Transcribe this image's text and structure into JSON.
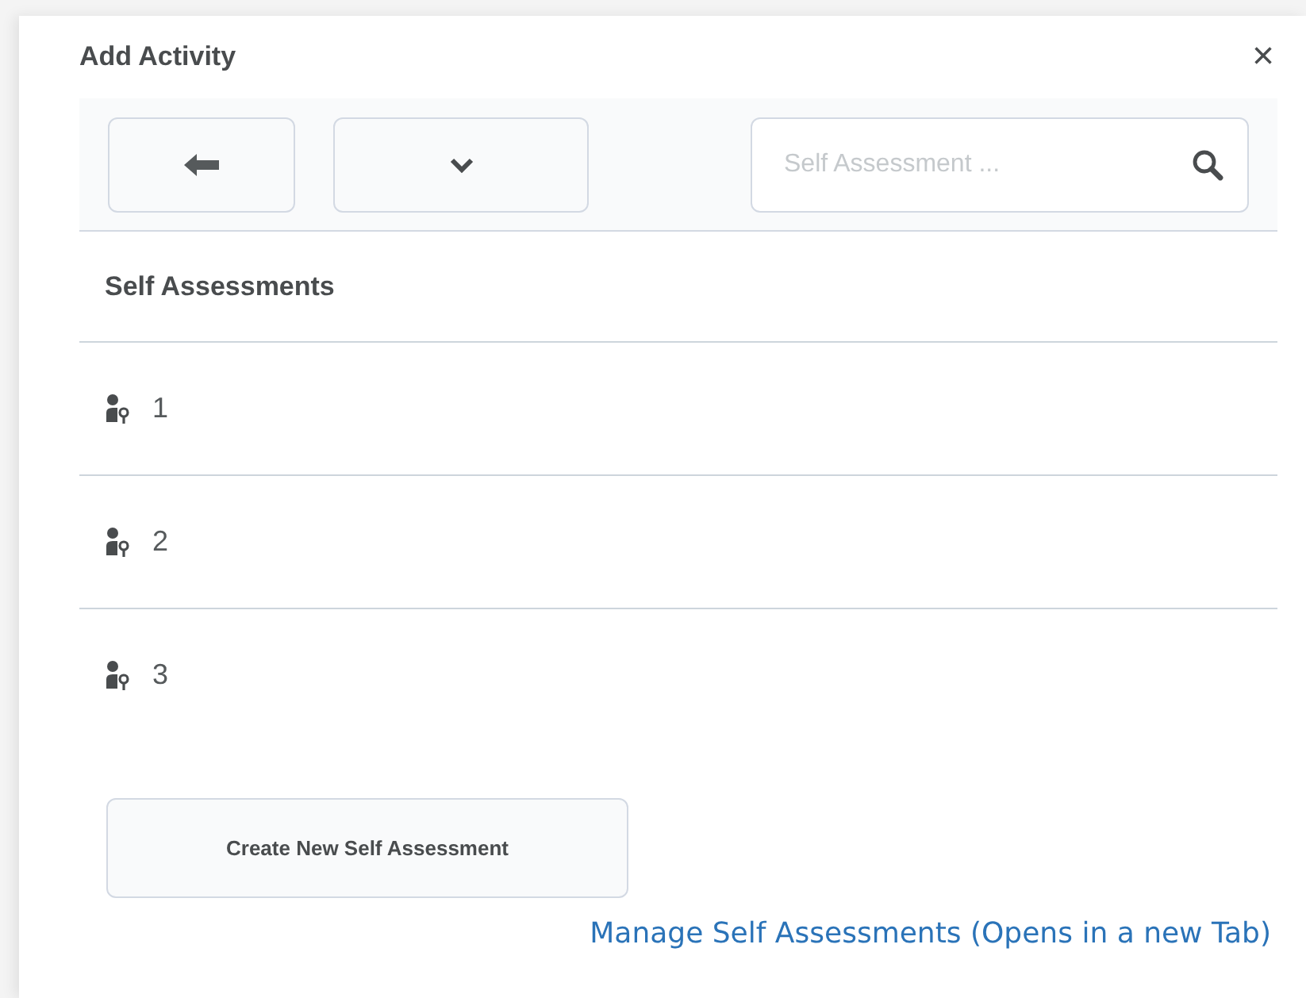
{
  "dialog": {
    "title": "Add Activity",
    "close": "×"
  },
  "toolbar": {
    "search": {
      "placeholder": "Self Assessment ..."
    }
  },
  "list": {
    "heading": "Self Assessments",
    "items": [
      {
        "label": "1"
      },
      {
        "label": "2"
      },
      {
        "label": "3"
      }
    ]
  },
  "create_button": "Create New Self Assessment",
  "manage_link": "Manage Self Assessments (Opens in a new Tab)"
}
